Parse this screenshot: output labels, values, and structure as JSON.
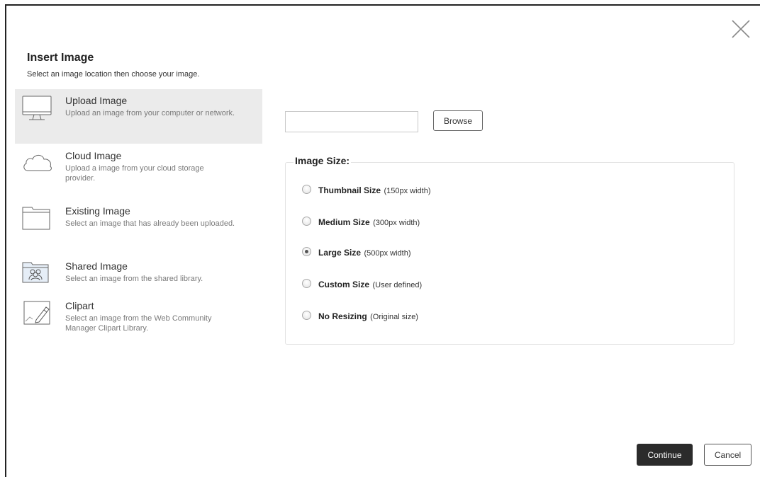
{
  "dialog": {
    "title": "Insert Image",
    "subtitle": "Select an image location then choose your image."
  },
  "sources": [
    {
      "name": "Upload Image",
      "desc": "Upload an image from your computer or network.",
      "icon": "monitor-icon",
      "selected": true
    },
    {
      "name": "Cloud Image",
      "desc": "Upload a image from your cloud storage provider.",
      "icon": "cloud-icon",
      "selected": false
    },
    {
      "name": "Existing Image",
      "desc": "Select an image that has already been uploaded.",
      "icon": "folder-icon",
      "selected": false
    },
    {
      "name": "Shared Image",
      "desc": "Select an image from the shared library.",
      "icon": "shared-folder-icon",
      "selected": false
    },
    {
      "name": "Clipart",
      "desc": "Select an image from the Web Community Manager Clipart Library.",
      "icon": "clipart-pen-icon",
      "selected": false
    }
  ],
  "upload": {
    "file_value": "",
    "browse_label": "Browse"
  },
  "image_size": {
    "legend": "Image Size:",
    "options": [
      {
        "label": "Thumbnail Size",
        "note": "(150px width)",
        "checked": false
      },
      {
        "label": "Medium Size",
        "note": "(300px width)",
        "checked": false
      },
      {
        "label": "Large Size",
        "note": "(500px width)",
        "checked": true
      },
      {
        "label": "Custom Size",
        "note": "(User defined)",
        "checked": false
      },
      {
        "label": "No Resizing",
        "note": "(Original size)",
        "checked": false
      }
    ]
  },
  "footer": {
    "continue_label": "Continue",
    "cancel_label": "Cancel"
  },
  "colors": {
    "selected_bg": "#ebebeb",
    "primary_button": "#2b2b2b"
  }
}
